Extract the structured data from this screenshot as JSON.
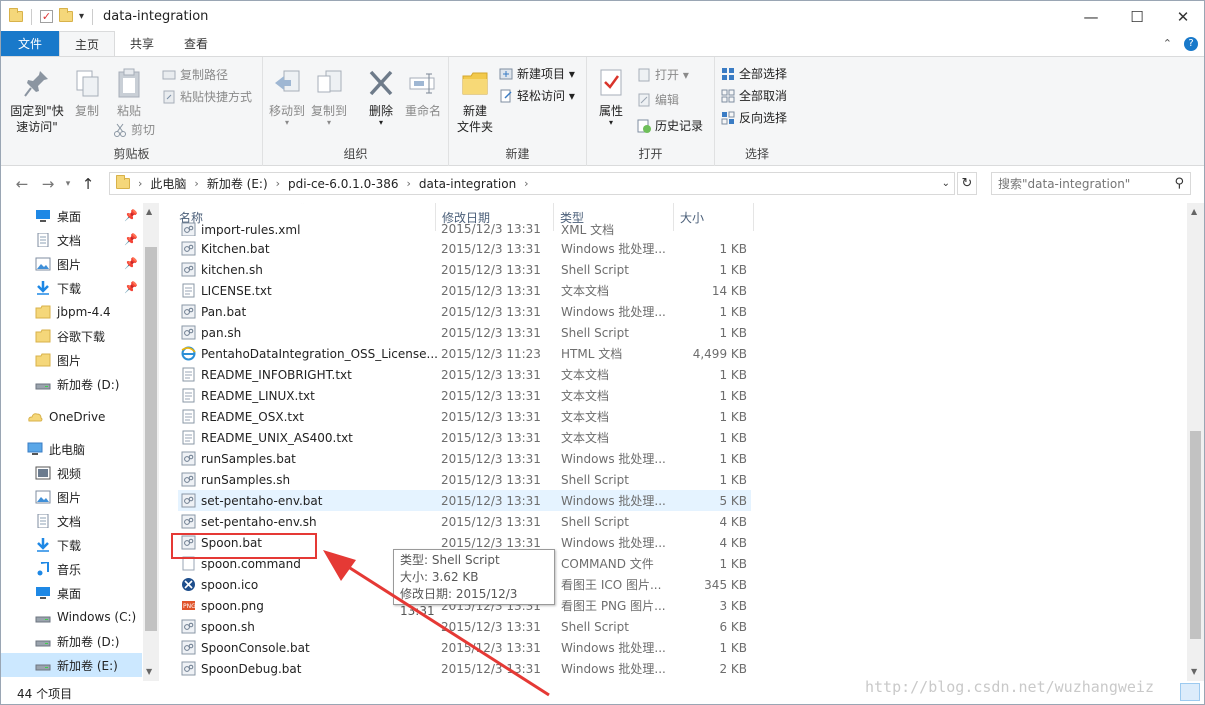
{
  "window": {
    "title": "data-integration",
    "controls": {
      "minimize": "—",
      "maximize": "☐",
      "close": "✕"
    }
  },
  "ribbon_tabs": [
    "文件",
    "主页",
    "共享",
    "查看"
  ],
  "ribbon": {
    "clipboard": {
      "label": "剪贴板",
      "pin_line1": "固定到\"快",
      "pin_line2": "速访问\"",
      "copy": "复制",
      "paste": "粘贴",
      "copy_path": "复制路径",
      "paste_shortcut": "粘贴快捷方式",
      "cut": "剪切"
    },
    "organize": {
      "label": "组织",
      "move_to": "移动到",
      "copy_to": "复制到",
      "delete": "删除",
      "rename": "重命名"
    },
    "new": {
      "label": "新建",
      "new_folder_line1": "新建",
      "new_folder_line2": "文件夹",
      "new_item": "新建项目 ▾",
      "easy_access": "轻松访问 ▾"
    },
    "open": {
      "label": "打开",
      "properties": "属性",
      "open": "打开 ▾",
      "edit": "编辑",
      "history": "历史记录"
    },
    "select": {
      "label": "选择",
      "select_all": "全部选择",
      "select_none": "全部取消",
      "invert": "反向选择"
    }
  },
  "address": {
    "breadcrumbs": [
      "此电脑",
      "新加卷 (E:)",
      "pdi-ce-6.0.1.0-386",
      "data-integration"
    ],
    "search_placeholder": "搜索\"data-integration\""
  },
  "nav_pane": [
    {
      "label": "桌面",
      "icon": "desktop-icon",
      "pinned": true
    },
    {
      "label": "文档",
      "icon": "documents-icon",
      "pinned": true
    },
    {
      "label": "图片",
      "icon": "pictures-icon",
      "pinned": true
    },
    {
      "label": "下载",
      "icon": "download-icon",
      "pinned": true
    },
    {
      "label": "jbpm-4.4",
      "icon": "folder-icon"
    },
    {
      "label": "谷歌下载",
      "icon": "folder-icon"
    },
    {
      "label": "图片",
      "icon": "folder-icon"
    },
    {
      "label": "新加卷 (D:)",
      "icon": "drive-icon"
    },
    {
      "label": "OneDrive",
      "icon": "onedrive-icon"
    },
    {
      "label": "此电脑",
      "icon": "computer-icon"
    },
    {
      "label": "视频",
      "icon": "video-icon"
    },
    {
      "label": "图片",
      "icon": "pictures-icon"
    },
    {
      "label": "文档",
      "icon": "documents-icon"
    },
    {
      "label": "下载",
      "icon": "download-icon"
    },
    {
      "label": "音乐",
      "icon": "music-icon"
    },
    {
      "label": "桌面",
      "icon": "desktop-icon"
    },
    {
      "label": "Windows (C:)",
      "icon": "drive-icon"
    },
    {
      "label": "新加卷 (D:)",
      "icon": "drive-icon"
    },
    {
      "label": "新加卷 (E:)",
      "icon": "drive-icon",
      "selected": true
    }
  ],
  "columns": [
    "名称",
    "修改日期",
    "类型",
    "大小"
  ],
  "files": [
    {
      "name": "import-rules.xml",
      "date": "2015/12/3 13:31",
      "type": "XML 文档",
      "size": "",
      "icon": "script-icon"
    },
    {
      "name": "Kitchen.bat",
      "date": "2015/12/3 13:31",
      "type": "Windows 批处理...",
      "size": "1 KB",
      "icon": "script-icon"
    },
    {
      "name": "kitchen.sh",
      "date": "2015/12/3 13:31",
      "type": "Shell Script",
      "size": "1 KB",
      "icon": "script-icon"
    },
    {
      "name": "LICENSE.txt",
      "date": "2015/12/3 13:31",
      "type": "文本文档",
      "size": "14 KB",
      "icon": "text-file-icon"
    },
    {
      "name": "Pan.bat",
      "date": "2015/12/3 13:31",
      "type": "Windows 批处理...",
      "size": "1 KB",
      "icon": "script-icon"
    },
    {
      "name": "pan.sh",
      "date": "2015/12/3 13:31",
      "type": "Shell Script",
      "size": "1 KB",
      "icon": "script-icon"
    },
    {
      "name": "PentahoDataIntegration_OSS_License...",
      "date": "2015/12/3 11:23",
      "type": "HTML 文档",
      "size": "4,499 KB",
      "icon": "ie-icon"
    },
    {
      "name": "README_INFOBRIGHT.txt",
      "date": "2015/12/3 13:31",
      "type": "文本文档",
      "size": "1 KB",
      "icon": "text-file-icon"
    },
    {
      "name": "README_LINUX.txt",
      "date": "2015/12/3 13:31",
      "type": "文本文档",
      "size": "1 KB",
      "icon": "text-file-icon"
    },
    {
      "name": "README_OSX.txt",
      "date": "2015/12/3 13:31",
      "type": "文本文档",
      "size": "1 KB",
      "icon": "text-file-icon"
    },
    {
      "name": "README_UNIX_AS400.txt",
      "date": "2015/12/3 13:31",
      "type": "文本文档",
      "size": "1 KB",
      "icon": "text-file-icon"
    },
    {
      "name": "runSamples.bat",
      "date": "2015/12/3 13:31",
      "type": "Windows 批处理...",
      "size": "1 KB",
      "icon": "script-icon"
    },
    {
      "name": "runSamples.sh",
      "date": "2015/12/3 13:31",
      "type": "Shell Script",
      "size": "1 KB",
      "icon": "script-icon"
    },
    {
      "name": "set-pentaho-env.bat",
      "date": "2015/12/3 13:31",
      "type": "Windows 批处理...",
      "size": "5 KB",
      "icon": "script-icon",
      "hover": true
    },
    {
      "name": "set-pentaho-env.sh",
      "date": "2015/12/3 13:31",
      "type": "Shell Script",
      "size": "4 KB",
      "icon": "script-icon"
    },
    {
      "name": "Spoon.bat",
      "date": "2015/12/3 13:31",
      "type": "Windows 批处理...",
      "size": "4 KB",
      "icon": "script-icon"
    },
    {
      "name": "spoon.command",
      "date": "2015/12/3 13:31",
      "type": "COMMAND 文件",
      "size": "1 KB",
      "icon": "blank-file-icon"
    },
    {
      "name": "spoon.ico",
      "date": "2015/12/3 13:31",
      "type": "看图王 ICO 图片...",
      "size": "345 KB",
      "icon": "ico-file-icon"
    },
    {
      "name": "spoon.png",
      "date": "2015/12/3 13:31",
      "type": "看图王 PNG 图片...",
      "size": "3 KB",
      "icon": "png-file-icon"
    },
    {
      "name": "spoon.sh",
      "date": "2015/12/3 13:31",
      "type": "Shell Script",
      "size": "6 KB",
      "icon": "script-icon"
    },
    {
      "name": "SpoonConsole.bat",
      "date": "2015/12/3 13:31",
      "type": "Windows 批处理...",
      "size": "1 KB",
      "icon": "script-icon"
    },
    {
      "name": "SpoonDebug.bat",
      "date": "2015/12/3 13:31",
      "type": "Windows 批处理...",
      "size": "2 KB",
      "icon": "script-icon"
    }
  ],
  "tooltip": {
    "type": "类型: Shell Script",
    "size": "大小: 3.62 KB",
    "date": "修改日期: 2015/12/3 13:31"
  },
  "status": {
    "item_count": "44 个项目"
  },
  "watermark": "http://blog.csdn.net/wuzhangweiz",
  "colors": {
    "accent": "#1979ca",
    "selection": "#cce8ff",
    "hover_row": "#e5f3ff",
    "annotation_red": "#e53935"
  }
}
